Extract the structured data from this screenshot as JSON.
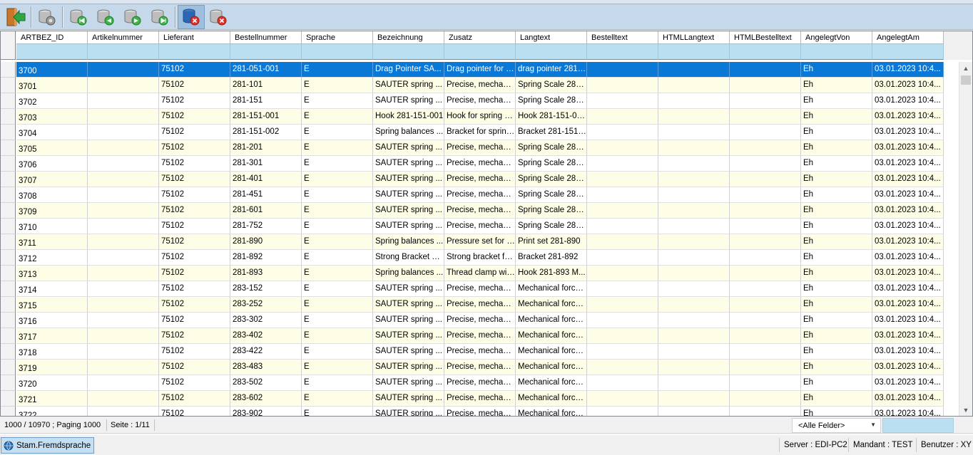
{
  "toolbar": {
    "buttons": [
      {
        "name": "exit-icon"
      },
      {
        "name": "database-settings-icon"
      },
      {
        "name": "database-first-icon"
      },
      {
        "name": "database-previous-icon"
      },
      {
        "name": "database-next-icon"
      },
      {
        "name": "database-last-icon"
      },
      {
        "name": "database-delete-all-icon"
      },
      {
        "name": "database-delete-icon"
      }
    ]
  },
  "grid": {
    "columns": [
      "ARTBEZ_ID",
      "Artikelnummer",
      "Lieferant",
      "Bestellnummer",
      "Sprache",
      "Bezeichnung",
      "Zusatz",
      "Langtext",
      "Bestelltext",
      "HTMLLangtext",
      "HTMLBestelltext",
      "AngelegtVon",
      "AngelegtAm"
    ],
    "rows": [
      [
        "3700",
        "",
        "75102",
        "281-051-001",
        "E",
        "Drag Pointer  SA...",
        "Drag pointer for s...",
        "drag pointer 281-...",
        "",
        "",
        "",
        "Eh",
        "03.01.2023 10:4..."
      ],
      [
        "3701",
        "",
        "75102",
        "281-101",
        "E",
        "SAUTER spring ...",
        "Precise, mechani...",
        "Spring Scale 281...",
        "",
        "",
        "",
        "Eh",
        "03.01.2023 10:4..."
      ],
      [
        "3702",
        "",
        "75102",
        "281-151",
        "E",
        "SAUTER spring ...",
        "Precise, mechani...",
        "Spring Scale 281...",
        "",
        "",
        "",
        "Eh",
        "03.01.2023 10:4..."
      ],
      [
        "3703",
        "",
        "75102",
        "281-151-001",
        "E",
        "Hook 281-151-001",
        "Hook for spring b...",
        "Hook 281-151-00...",
        "",
        "",
        "",
        "Eh",
        "03.01.2023 10:4..."
      ],
      [
        "3704",
        "",
        "75102",
        "281-151-002",
        "E",
        "Spring balances ...",
        "Bracket for spring...",
        "Bracket 281-151-...",
        "",
        "",
        "",
        "Eh",
        "03.01.2023 10:4..."
      ],
      [
        "3705",
        "",
        "75102",
        "281-201",
        "E",
        "SAUTER spring ...",
        "Precise, mechani...",
        "Spring Scale 281...",
        "",
        "",
        "",
        "Eh",
        "03.01.2023 10:4..."
      ],
      [
        "3706",
        "",
        "75102",
        "281-301",
        "E",
        "SAUTER spring ...",
        "Precise, mechani...",
        "Spring Scale 281...",
        "",
        "",
        "",
        "Eh",
        "03.01.2023 10:4..."
      ],
      [
        "3707",
        "",
        "75102",
        "281-401",
        "E",
        "SAUTER spring ...",
        "Precise, mechani...",
        "Spring Scale 281...",
        "",
        "",
        "",
        "Eh",
        "03.01.2023 10:4..."
      ],
      [
        "3708",
        "",
        "75102",
        "281-451",
        "E",
        "SAUTER spring ...",
        "Precise, mechani...",
        "Spring Scale 281...",
        "",
        "",
        "",
        "Eh",
        "03.01.2023 10:4..."
      ],
      [
        "3709",
        "",
        "75102",
        "281-601",
        "E",
        "SAUTER spring ...",
        "Precise, mechani...",
        "Spring Scale 281...",
        "",
        "",
        "",
        "Eh",
        "03.01.2023 10:4..."
      ],
      [
        "3710",
        "",
        "75102",
        "281-752",
        "E",
        "SAUTER spring ...",
        "Precise, mechani...",
        "Spring Scale 281...",
        "",
        "",
        "",
        "Eh",
        "03.01.2023 10:4..."
      ],
      [
        "3711",
        "",
        "75102",
        "281-890",
        "E",
        "Spring balances ...",
        "Pressure set for s...",
        "Print set 281-890",
        "",
        "",
        "",
        "Eh",
        "03.01.2023 10:4..."
      ],
      [
        "3712",
        "",
        "75102",
        "281-892",
        "E",
        "Strong Bracket S...",
        "Strong bracket fo...",
        "Bracket 281-892",
        "",
        "",
        "",
        "Eh",
        "03.01.2023 10:4..."
      ],
      [
        "3713",
        "",
        "75102",
        "281-893",
        "E",
        "Spring balances ...",
        "Thread clamp wit...",
        "Hook 281-893 M...",
        "",
        "",
        "",
        "Eh",
        "03.01.2023 10:4..."
      ],
      [
        "3714",
        "",
        "75102",
        "283-152",
        "E",
        "SAUTER spring ...",
        "Precise, mechani...",
        "Mechanical force...",
        "",
        "",
        "",
        "Eh",
        "03.01.2023 10:4..."
      ],
      [
        "3715",
        "",
        "75102",
        "283-252",
        "E",
        "SAUTER spring ...",
        "Precise, mechani...",
        "Mechanical force...",
        "",
        "",
        "",
        "Eh",
        "03.01.2023 10:4..."
      ],
      [
        "3716",
        "",
        "75102",
        "283-302",
        "E",
        "SAUTER spring ...",
        "Precise, mechani...",
        "Mechanical force...",
        "",
        "",
        "",
        "Eh",
        "03.01.2023 10:4..."
      ],
      [
        "3717",
        "",
        "75102",
        "283-402",
        "E",
        "SAUTER spring ...",
        "Precise, mechani...",
        "Mechanical force...",
        "",
        "",
        "",
        "Eh",
        "03.01.2023 10:4..."
      ],
      [
        "3718",
        "",
        "75102",
        "283-422",
        "E",
        "SAUTER spring ...",
        "Precise, mechani...",
        "Mechanical force...",
        "",
        "",
        "",
        "Eh",
        "03.01.2023 10:4..."
      ],
      [
        "3719",
        "",
        "75102",
        "283-483",
        "E",
        "SAUTER spring ...",
        "Precise, mechani...",
        "Mechanical force...",
        "",
        "",
        "",
        "Eh",
        "03.01.2023 10:4..."
      ],
      [
        "3720",
        "",
        "75102",
        "283-502",
        "E",
        "SAUTER spring ...",
        "Precise, mechani...",
        "Mechanical force...",
        "",
        "",
        "",
        "Eh",
        "03.01.2023 10:4..."
      ],
      [
        "3721",
        "",
        "75102",
        "283-602",
        "E",
        "SAUTER spring ...",
        "Precise, mechani...",
        "Mechanical force...",
        "",
        "",
        "",
        "Eh",
        "03.01.2023 10:4..."
      ],
      [
        "3722",
        "",
        "75102",
        "283-902",
        "E",
        "SAUTER spring ...",
        "Precise, mechani...",
        "Mechanical force...",
        "",
        "",
        "",
        "Eh",
        "03.01.2023 10:4..."
      ]
    ],
    "selected_row": 0
  },
  "pagebar": {
    "count": "1000 / 10970 ; Paging 1000",
    "page": "Seite : 1/11",
    "field_filter": "<Alle Felder>"
  },
  "statusbar": {
    "tab_label": "Stam.Fremdsprache",
    "server": "Server : EDI-PC2",
    "mandant": "Mandant : TEST",
    "benutzer": "Benutzer : XY"
  },
  "colors": {
    "selection": "#0a78d7",
    "row_alt": "#fefde6",
    "filter_row": "#b9dff0",
    "toolbar": "#c5d9eb"
  }
}
